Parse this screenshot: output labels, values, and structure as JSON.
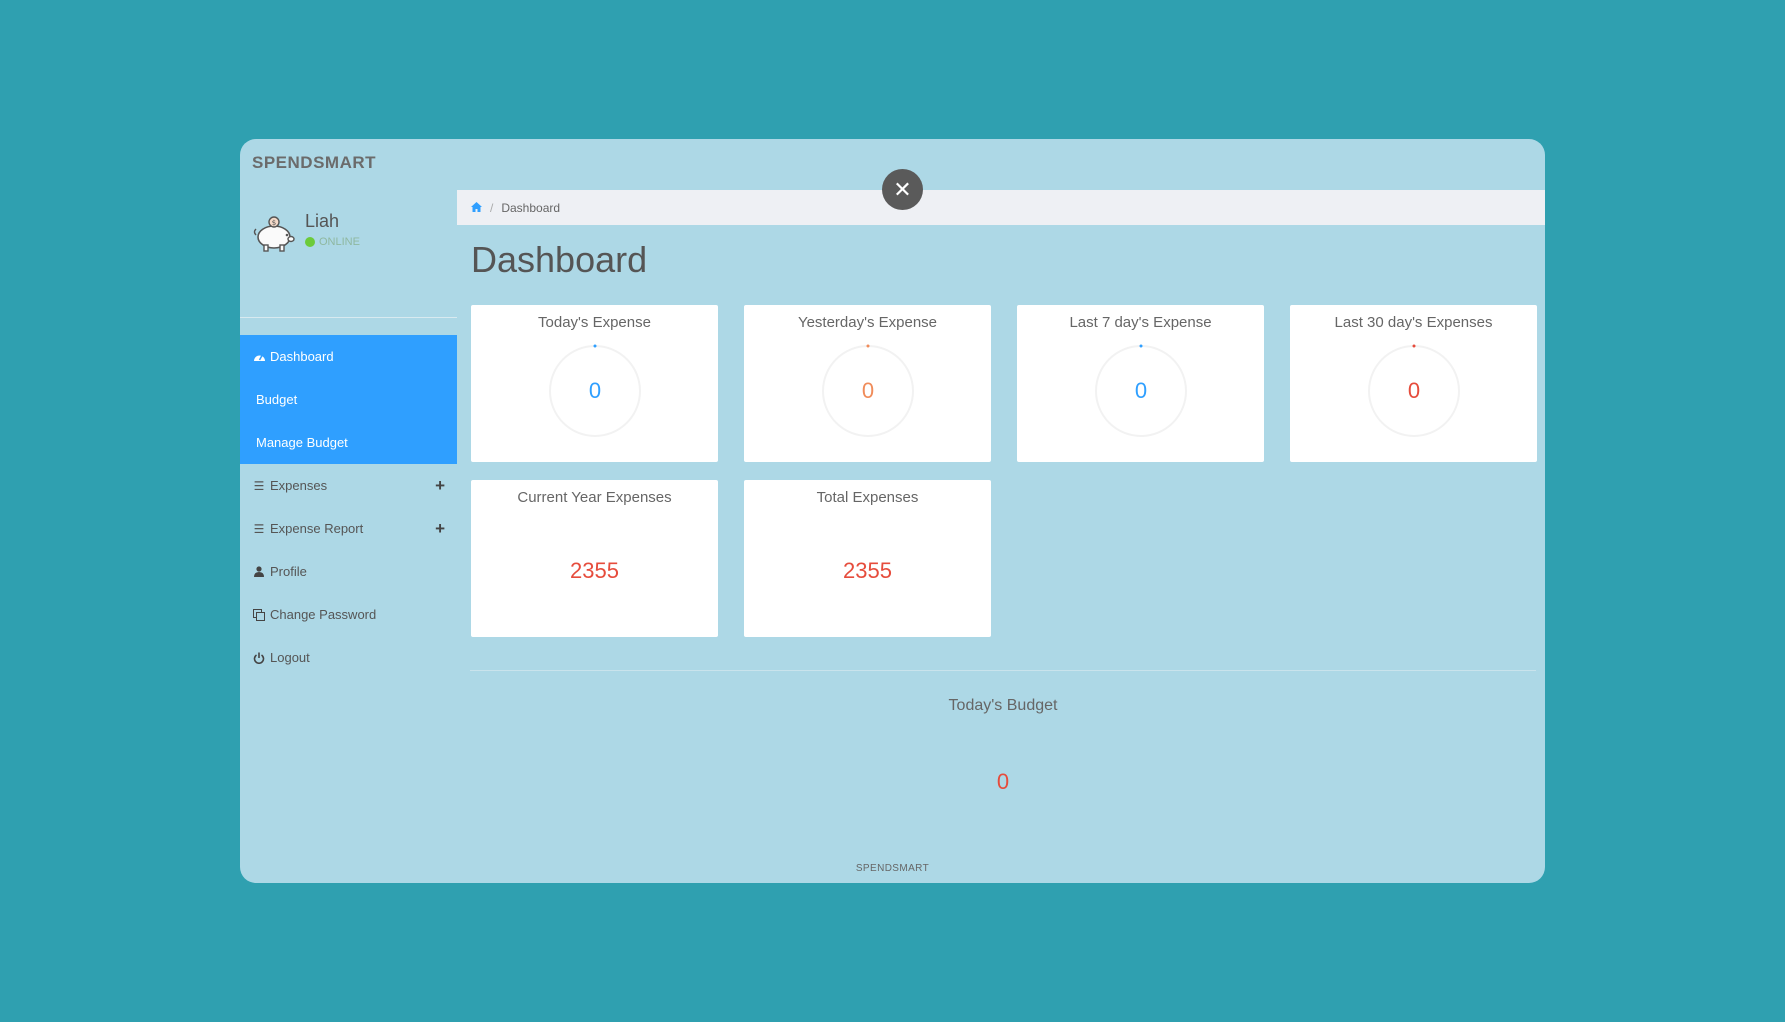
{
  "app": {
    "brand": "SPENDSMART",
    "footer": "SPENDSMART"
  },
  "user": {
    "name": "Liah",
    "status": "ONLINE"
  },
  "colors": {
    "accent": "#2f9fff",
    "blue": "#2f9fff",
    "orange": "#f08c5a",
    "red": "#e64c3c",
    "teal_background": "#2fa0b0"
  },
  "sidebar": {
    "items": [
      {
        "label": "Dashboard",
        "icon": "tachometer-icon"
      },
      {
        "label": "Budget"
      },
      {
        "label": "Manage Budget"
      },
      {
        "label": "Expenses",
        "icon": "bars-icon",
        "expand": "plus-icon"
      },
      {
        "label": "Expense Report",
        "icon": "bars-icon",
        "expand": "plus-icon"
      },
      {
        "label": "Profile",
        "icon": "user-icon"
      },
      {
        "label": "Change Password",
        "icon": "copy-icon"
      },
      {
        "label": "Logout",
        "icon": "power-icon"
      }
    ]
  },
  "breadcrumb": {
    "current": "Dashboard"
  },
  "page": {
    "title": "Dashboard"
  },
  "cards": [
    {
      "title": "Today's Expense",
      "value": "0",
      "color": "#2f9fff"
    },
    {
      "title": "Yesterday's Expense",
      "value": "0",
      "color": "#f08c5a"
    },
    {
      "title": "Last 7 day's Expense",
      "value": "0",
      "color": "#2f9fff"
    },
    {
      "title": "Last 30 day's Expenses",
      "value": "0",
      "color": "#e64c3c"
    },
    {
      "title": "Current Year Expenses",
      "value": "2355",
      "color": "#e64c3c"
    },
    {
      "title": "Total Expenses",
      "value": "2355",
      "color": "#e64c3c"
    }
  ],
  "budget": {
    "title": "Today's Budget",
    "value": "0",
    "color": "#e64c3c"
  }
}
